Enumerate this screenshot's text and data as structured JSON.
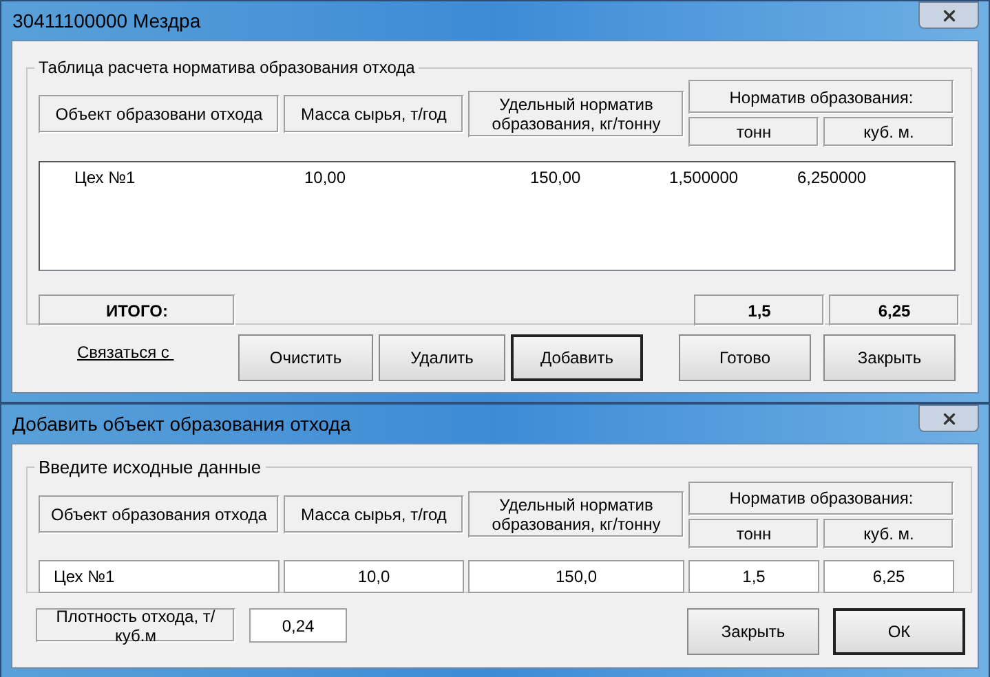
{
  "main_window": {
    "title": "30411100000 Мездра",
    "group_title": "Таблица расчета норматива образования отхода",
    "columns": [
      "Объект образовани отхода",
      "Масса сырья, т/год",
      "Удельный норматив образования, кг/тонну"
    ],
    "norm_header": "Норматив образования:",
    "norm_columns": [
      "тонн",
      "куб. м."
    ],
    "rows": [
      {
        "cells": [
          "Цех №1",
          "10,00",
          "150,00",
          "1,500000",
          "6,250000"
        ]
      }
    ],
    "total_label": "ИТОГО:",
    "totals": [
      "1,5",
      "6,25"
    ],
    "link": "Связаться с ",
    "buttons": [
      {
        "label": "Очистить",
        "default": false
      },
      {
        "label": "Удалить",
        "default": false
      },
      {
        "label": "Добавить",
        "default": true
      },
      {
        "label": "Готово",
        "default": false
      },
      {
        "label": "Закрыть",
        "default": false
      }
    ]
  },
  "add_window": {
    "title": "Добавить объект образования отхода",
    "group_title": "Введите исходные данные",
    "columns": [
      "Объект образования отхода",
      "Масса сырья, т/год",
      "Удельный норматив образования, кг/тонну"
    ],
    "norm_header": "Норматив образования:",
    "norm_columns": [
      "тонн",
      "куб. м."
    ],
    "inputs": [
      "Цех №1",
      "10,0",
      "150,0",
      "1,5",
      "6,25"
    ],
    "density_label": "Плотность отхода, т/куб.м",
    "density_value": "0,24",
    "buttons": [
      {
        "label": "Закрыть",
        "default": false
      },
      {
        "label": "ОК",
        "default": true
      }
    ]
  }
}
